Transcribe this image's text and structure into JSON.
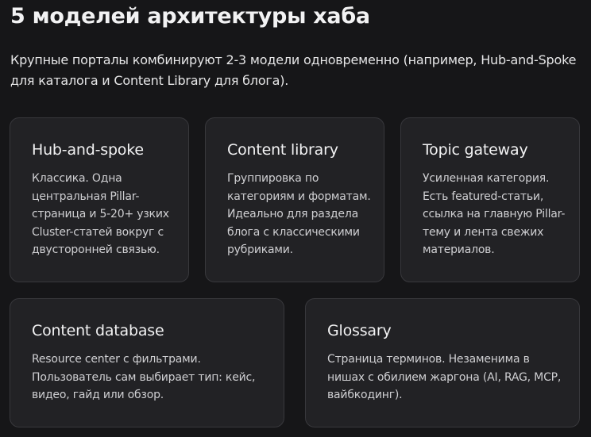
{
  "header": {
    "title": "5 моделей архитектуры хаба",
    "intro": "Крупные порталы комбинируют 2-3 модели одновременно (например, Hub-and-Spoke для каталога и Content Library для блога)."
  },
  "cards": [
    {
      "title": "Hub-and-spoke",
      "text": "Классика. Одна центральная Pillar-страница и 5-20+ узких Cluster-статей вокруг с двусторонней связью."
    },
    {
      "title": "Content library",
      "text": "Группировка по категориям и форматам. Идеально для раздела блога с классическими рубриками."
    },
    {
      "title": "Topic gateway",
      "text": "Усиленная категория. Есть featured-статьи, ссылка на главную Pillar-тему и лента свежих материалов."
    },
    {
      "title": "Content database",
      "text": "Resource center с фильтрами. Пользователь сам выбирает тип: кейс, видео, гайд или обзор."
    },
    {
      "title": "Glossary",
      "text": "Страница терминов. Незаменима в нишах с обилием жаргона (AI, RAG, MCP, вайбкодинг)."
    }
  ]
}
